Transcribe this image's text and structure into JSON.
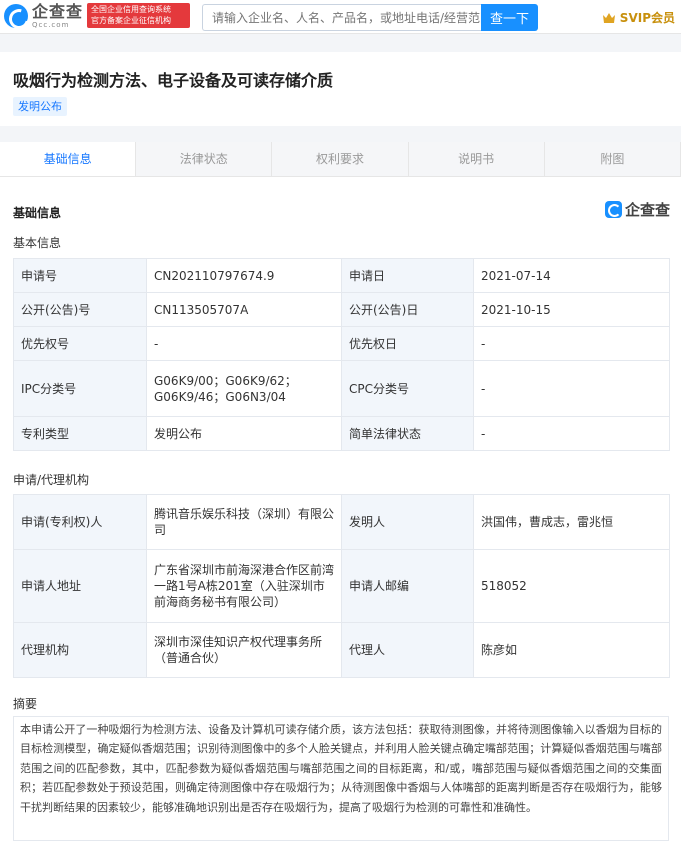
{
  "header": {
    "logo_cn": "企查查",
    "logo_en": "Qcc.com",
    "cert_line1": "全国企业信用查询系统",
    "cert_line2": "官方备案企业征信机构",
    "search_placeholder": "请输入企业名、人名、产品名，或地址电话/经营范围",
    "search_button": "查一下",
    "vip_label": "SVIP会员"
  },
  "patent": {
    "title": "吸烟行为检测方法、电子设备及可读存储介质",
    "status_tag": "发明公布"
  },
  "tabs": [
    {
      "label": "基础信息"
    },
    {
      "label": "法律状态"
    },
    {
      "label": "权利要求"
    },
    {
      "label": "说明书"
    },
    {
      "label": "附图"
    }
  ],
  "section": {
    "title": "基础信息",
    "brand": "企查查",
    "basic_subtitle": "基本信息",
    "agency_subtitle": "申请/代理机构",
    "abstract_subtitle": "摘要"
  },
  "basic_info": [
    {
      "k1": "申请号",
      "v1": "CN202110797674.9",
      "k2": "申请日",
      "v2": "2021-07-14"
    },
    {
      "k1": "公开(公告)号",
      "v1": "CN113505707A",
      "k2": "公开(公告)日",
      "v2": "2021-10-15"
    },
    {
      "k1": "优先权号",
      "v1": "-",
      "k2": "优先权日",
      "v2": "-"
    },
    {
      "k1": "IPC分类号",
      "v1": "G06K9/00；G06K9/62；G06K9/46；G06N3/04",
      "k2": "CPC分类号",
      "v2": "-"
    },
    {
      "k1": "专利类型",
      "v1": "发明公布",
      "k2": "简单法律状态",
      "v2": "-"
    }
  ],
  "agency_info": [
    {
      "k1": "申请(专利权)人",
      "v1": "腾讯音乐娱乐科技（深圳）有限公司",
      "k2": "发明人",
      "v2": "洪国伟，曹成志，雷兆恒"
    },
    {
      "k1": "申请人地址",
      "v1": "广东省深圳市前海深港合作区前湾一路1号A栋201室（入驻深圳市前海商务秘书有限公司）",
      "k2": "申请人邮编",
      "v2": "518052"
    },
    {
      "k1": "代理机构",
      "v1": "深圳市深佳知识产权代理事务所（普通合伙）",
      "k2": "代理人",
      "v2": "陈彦如"
    }
  ],
  "abstract": "本申请公开了一种吸烟行为检测方法、设备及计算机可读存储介质，该方法包括：获取待测图像，并将待测图像输入以香烟为目标的目标检测模型，确定疑似香烟范围；识别待测图像中的多个人脸关键点，并利用人脸关键点确定嘴部范围；计算疑似香烟范围与嘴部范围之间的匹配参数，其中，匹配参数为疑似香烟范围与嘴部范围之间的目标距离，和/或，嘴部范围与疑似香烟范围之间的交集面积；若匹配参数处于预设范围，则确定待测图像中存在吸烟行为；从待测图像中香烟与人体嘴部的距离判断是否存在吸烟行为，能够干扰判断结果的因素较少，能够准确地识别出是否存在吸烟行为，提高了吸烟行为检测的可靠性和准确性。"
}
